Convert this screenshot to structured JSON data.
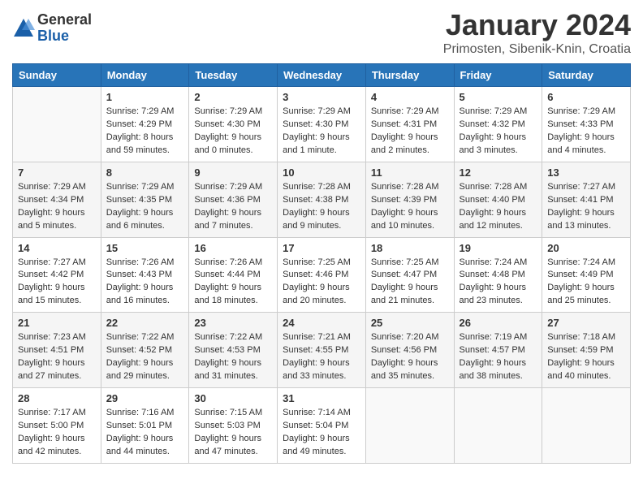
{
  "header": {
    "logo_general": "General",
    "logo_blue": "Blue",
    "month_title": "January 2024",
    "location": "Primosten, Sibenik-Knin, Croatia"
  },
  "weekdays": [
    "Sunday",
    "Monday",
    "Tuesday",
    "Wednesday",
    "Thursday",
    "Friday",
    "Saturday"
  ],
  "weeks": [
    [
      {
        "day": "",
        "sunrise": "",
        "sunset": "",
        "daylight": ""
      },
      {
        "day": "1",
        "sunrise": "Sunrise: 7:29 AM",
        "sunset": "Sunset: 4:29 PM",
        "daylight": "Daylight: 8 hours and 59 minutes."
      },
      {
        "day": "2",
        "sunrise": "Sunrise: 7:29 AM",
        "sunset": "Sunset: 4:30 PM",
        "daylight": "Daylight: 9 hours and 0 minutes."
      },
      {
        "day": "3",
        "sunrise": "Sunrise: 7:29 AM",
        "sunset": "Sunset: 4:30 PM",
        "daylight": "Daylight: 9 hours and 1 minute."
      },
      {
        "day": "4",
        "sunrise": "Sunrise: 7:29 AM",
        "sunset": "Sunset: 4:31 PM",
        "daylight": "Daylight: 9 hours and 2 minutes."
      },
      {
        "day": "5",
        "sunrise": "Sunrise: 7:29 AM",
        "sunset": "Sunset: 4:32 PM",
        "daylight": "Daylight: 9 hours and 3 minutes."
      },
      {
        "day": "6",
        "sunrise": "Sunrise: 7:29 AM",
        "sunset": "Sunset: 4:33 PM",
        "daylight": "Daylight: 9 hours and 4 minutes."
      }
    ],
    [
      {
        "day": "7",
        "sunrise": "Sunrise: 7:29 AM",
        "sunset": "Sunset: 4:34 PM",
        "daylight": "Daylight: 9 hours and 5 minutes."
      },
      {
        "day": "8",
        "sunrise": "Sunrise: 7:29 AM",
        "sunset": "Sunset: 4:35 PM",
        "daylight": "Daylight: 9 hours and 6 minutes."
      },
      {
        "day": "9",
        "sunrise": "Sunrise: 7:29 AM",
        "sunset": "Sunset: 4:36 PM",
        "daylight": "Daylight: 9 hours and 7 minutes."
      },
      {
        "day": "10",
        "sunrise": "Sunrise: 7:28 AM",
        "sunset": "Sunset: 4:38 PM",
        "daylight": "Daylight: 9 hours and 9 minutes."
      },
      {
        "day": "11",
        "sunrise": "Sunrise: 7:28 AM",
        "sunset": "Sunset: 4:39 PM",
        "daylight": "Daylight: 9 hours and 10 minutes."
      },
      {
        "day": "12",
        "sunrise": "Sunrise: 7:28 AM",
        "sunset": "Sunset: 4:40 PM",
        "daylight": "Daylight: 9 hours and 12 minutes."
      },
      {
        "day": "13",
        "sunrise": "Sunrise: 7:27 AM",
        "sunset": "Sunset: 4:41 PM",
        "daylight": "Daylight: 9 hours and 13 minutes."
      }
    ],
    [
      {
        "day": "14",
        "sunrise": "Sunrise: 7:27 AM",
        "sunset": "Sunset: 4:42 PM",
        "daylight": "Daylight: 9 hours and 15 minutes."
      },
      {
        "day": "15",
        "sunrise": "Sunrise: 7:26 AM",
        "sunset": "Sunset: 4:43 PM",
        "daylight": "Daylight: 9 hours and 16 minutes."
      },
      {
        "day": "16",
        "sunrise": "Sunrise: 7:26 AM",
        "sunset": "Sunset: 4:44 PM",
        "daylight": "Daylight: 9 hours and 18 minutes."
      },
      {
        "day": "17",
        "sunrise": "Sunrise: 7:25 AM",
        "sunset": "Sunset: 4:46 PM",
        "daylight": "Daylight: 9 hours and 20 minutes."
      },
      {
        "day": "18",
        "sunrise": "Sunrise: 7:25 AM",
        "sunset": "Sunset: 4:47 PM",
        "daylight": "Daylight: 9 hours and 21 minutes."
      },
      {
        "day": "19",
        "sunrise": "Sunrise: 7:24 AM",
        "sunset": "Sunset: 4:48 PM",
        "daylight": "Daylight: 9 hours and 23 minutes."
      },
      {
        "day": "20",
        "sunrise": "Sunrise: 7:24 AM",
        "sunset": "Sunset: 4:49 PM",
        "daylight": "Daylight: 9 hours and 25 minutes."
      }
    ],
    [
      {
        "day": "21",
        "sunrise": "Sunrise: 7:23 AM",
        "sunset": "Sunset: 4:51 PM",
        "daylight": "Daylight: 9 hours and 27 minutes."
      },
      {
        "day": "22",
        "sunrise": "Sunrise: 7:22 AM",
        "sunset": "Sunset: 4:52 PM",
        "daylight": "Daylight: 9 hours and 29 minutes."
      },
      {
        "day": "23",
        "sunrise": "Sunrise: 7:22 AM",
        "sunset": "Sunset: 4:53 PM",
        "daylight": "Daylight: 9 hours and 31 minutes."
      },
      {
        "day": "24",
        "sunrise": "Sunrise: 7:21 AM",
        "sunset": "Sunset: 4:55 PM",
        "daylight": "Daylight: 9 hours and 33 minutes."
      },
      {
        "day": "25",
        "sunrise": "Sunrise: 7:20 AM",
        "sunset": "Sunset: 4:56 PM",
        "daylight": "Daylight: 9 hours and 35 minutes."
      },
      {
        "day": "26",
        "sunrise": "Sunrise: 7:19 AM",
        "sunset": "Sunset: 4:57 PM",
        "daylight": "Daylight: 9 hours and 38 minutes."
      },
      {
        "day": "27",
        "sunrise": "Sunrise: 7:18 AM",
        "sunset": "Sunset: 4:59 PM",
        "daylight": "Daylight: 9 hours and 40 minutes."
      }
    ],
    [
      {
        "day": "28",
        "sunrise": "Sunrise: 7:17 AM",
        "sunset": "Sunset: 5:00 PM",
        "daylight": "Daylight: 9 hours and 42 minutes."
      },
      {
        "day": "29",
        "sunrise": "Sunrise: 7:16 AM",
        "sunset": "Sunset: 5:01 PM",
        "daylight": "Daylight: 9 hours and 44 minutes."
      },
      {
        "day": "30",
        "sunrise": "Sunrise: 7:15 AM",
        "sunset": "Sunset: 5:03 PM",
        "daylight": "Daylight: 9 hours and 47 minutes."
      },
      {
        "day": "31",
        "sunrise": "Sunrise: 7:14 AM",
        "sunset": "Sunset: 5:04 PM",
        "daylight": "Daylight: 9 hours and 49 minutes."
      },
      {
        "day": "",
        "sunrise": "",
        "sunset": "",
        "daylight": ""
      },
      {
        "day": "",
        "sunrise": "",
        "sunset": "",
        "daylight": ""
      },
      {
        "day": "",
        "sunrise": "",
        "sunset": "",
        "daylight": ""
      }
    ]
  ]
}
